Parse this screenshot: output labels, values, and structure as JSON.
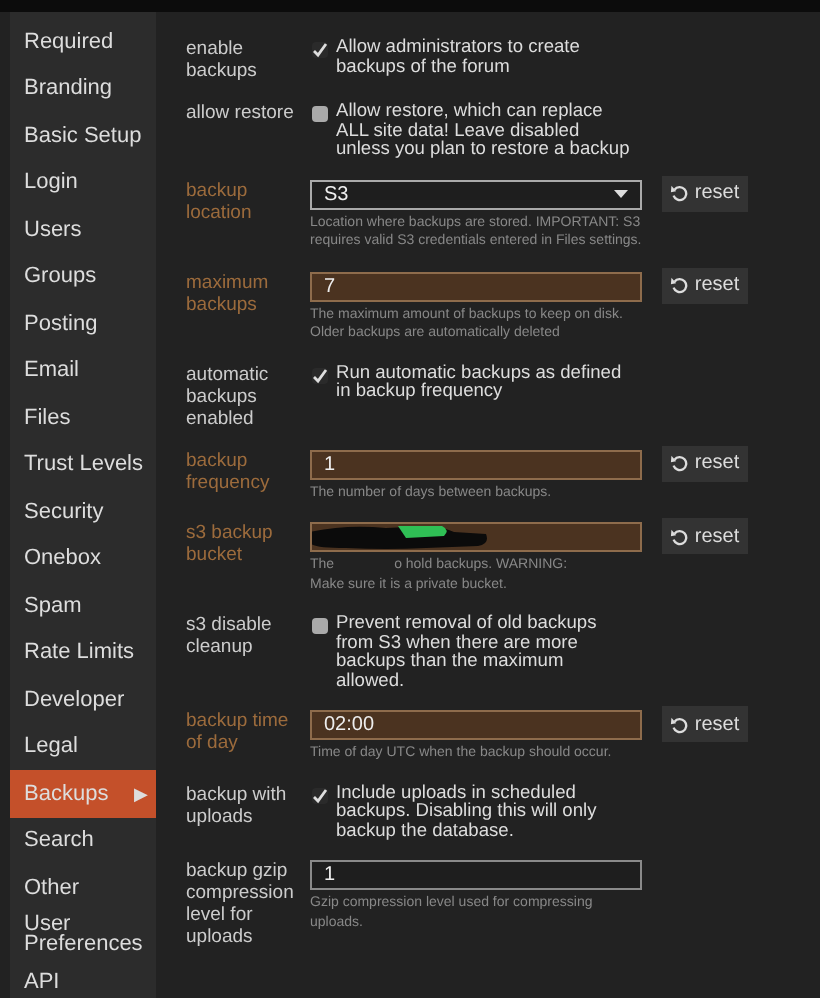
{
  "sidebar": {
    "items": [
      {
        "label": "Required",
        "selected": false
      },
      {
        "label": "Branding",
        "selected": false
      },
      {
        "label": "Basic Setup",
        "selected": false
      },
      {
        "label": "Login",
        "selected": false
      },
      {
        "label": "Users",
        "selected": false
      },
      {
        "label": "Groups",
        "selected": false
      },
      {
        "label": "Posting",
        "selected": false
      },
      {
        "label": "Email",
        "selected": false
      },
      {
        "label": "Files",
        "selected": false
      },
      {
        "label": "Trust Levels",
        "selected": false
      },
      {
        "label": "Security",
        "selected": false
      },
      {
        "label": "Onebox",
        "selected": false
      },
      {
        "label": "Spam",
        "selected": false
      },
      {
        "label": "Rate Limits",
        "selected": false
      },
      {
        "label": "Developer",
        "selected": false
      },
      {
        "label": "Legal",
        "selected": false
      },
      {
        "label": "Backups",
        "selected": true,
        "arrow": "▶"
      },
      {
        "label": "Search",
        "selected": false
      },
      {
        "label": "Other",
        "selected": false
      },
      {
        "label": "User Preferences",
        "selected": false
      },
      {
        "label": "API",
        "selected": false
      }
    ]
  },
  "settings": [
    {
      "kind": "checkbox",
      "label": "enable backups",
      "overridden": false,
      "checked": true,
      "text": "Allow administrators to create backups of the forum"
    },
    {
      "kind": "checkbox",
      "label": "allow restore",
      "overridden": false,
      "checked": false,
      "text": "Allow restore, which can replace ALL site data! Leave disabled unless you plan to restore a backup"
    },
    {
      "kind": "select",
      "label": "backup location",
      "overridden": true,
      "value": "S3",
      "description": "Location where backups are stored. IMPORTANT: S3 requires valid S3 credentials entered in Files settings.",
      "reset": "reset"
    },
    {
      "kind": "text",
      "label": "maximum backups",
      "overridden": true,
      "value": "7",
      "description": "The maximum amount of backups to keep on disk. Older backups are automatically deleted",
      "reset": "reset"
    },
    {
      "kind": "checkbox",
      "label": "automatic backups enabled",
      "overridden": false,
      "checked": true,
      "text": "Run automatic backups as defined in backup frequency"
    },
    {
      "kind": "text",
      "label": "backup frequency",
      "overridden": true,
      "value": "1",
      "description": "The number of days between backups.",
      "reset": "reset"
    },
    {
      "kind": "text",
      "label": "s3 backup bucket",
      "overridden": true,
      "redacted": true,
      "description_pieces": [
        "The",
        "o hold backups. WARNING:",
        "Make sure it is a private bucket."
      ],
      "reset": "reset"
    },
    {
      "kind": "checkbox",
      "label": "s3 disable cleanup",
      "overridden": false,
      "checked": false,
      "text": "Prevent removal of old backups from S3 when there are more backups than the maximum allowed."
    },
    {
      "kind": "text",
      "label": "backup time of day",
      "overridden": true,
      "value": "02:00",
      "description": "Time of day UTC when the backup should occur.",
      "reset": "reset"
    },
    {
      "kind": "checkbox",
      "label": "backup with uploads",
      "overridden": false,
      "checked": true,
      "text": "Include uploads in scheduled backups. Disabling this will only backup the database."
    },
    {
      "kind": "text",
      "label": "backup gzip compression level for uploads",
      "overridden": false,
      "value": "1",
      "description": "Gzip compression level used for compressing uploads."
    }
  ]
}
